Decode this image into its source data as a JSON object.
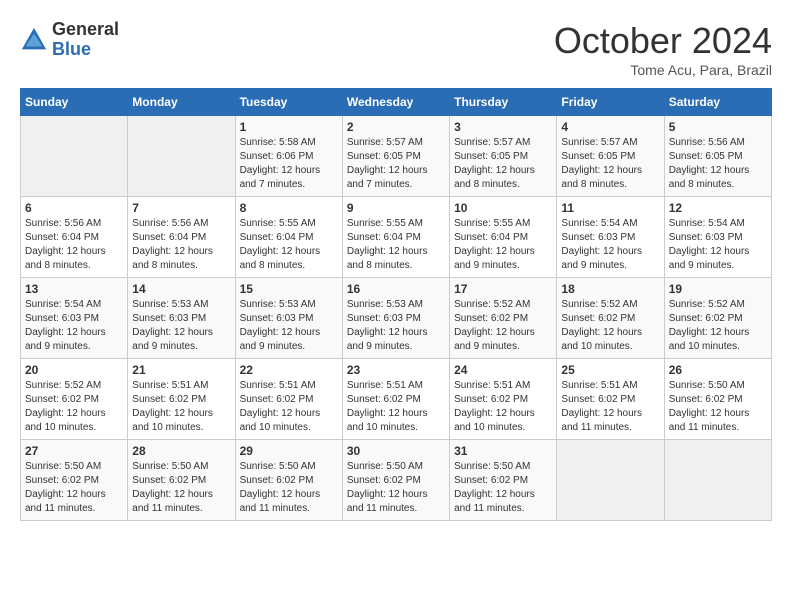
{
  "logo": {
    "general": "General",
    "blue": "Blue"
  },
  "title": "October 2024",
  "subtitle": "Tome Acu, Para, Brazil",
  "days_of_week": [
    "Sunday",
    "Monday",
    "Tuesday",
    "Wednesday",
    "Thursday",
    "Friday",
    "Saturday"
  ],
  "weeks": [
    [
      {
        "day": "",
        "sunrise": "",
        "sunset": "",
        "daylight": ""
      },
      {
        "day": "",
        "sunrise": "",
        "sunset": "",
        "daylight": ""
      },
      {
        "day": "1",
        "sunrise": "Sunrise: 5:58 AM",
        "sunset": "Sunset: 6:06 PM",
        "daylight": "Daylight: 12 hours and 7 minutes."
      },
      {
        "day": "2",
        "sunrise": "Sunrise: 5:57 AM",
        "sunset": "Sunset: 6:05 PM",
        "daylight": "Daylight: 12 hours and 7 minutes."
      },
      {
        "day": "3",
        "sunrise": "Sunrise: 5:57 AM",
        "sunset": "Sunset: 6:05 PM",
        "daylight": "Daylight: 12 hours and 8 minutes."
      },
      {
        "day": "4",
        "sunrise": "Sunrise: 5:57 AM",
        "sunset": "Sunset: 6:05 PM",
        "daylight": "Daylight: 12 hours and 8 minutes."
      },
      {
        "day": "5",
        "sunrise": "Sunrise: 5:56 AM",
        "sunset": "Sunset: 6:05 PM",
        "daylight": "Daylight: 12 hours and 8 minutes."
      }
    ],
    [
      {
        "day": "6",
        "sunrise": "Sunrise: 5:56 AM",
        "sunset": "Sunset: 6:04 PM",
        "daylight": "Daylight: 12 hours and 8 minutes."
      },
      {
        "day": "7",
        "sunrise": "Sunrise: 5:56 AM",
        "sunset": "Sunset: 6:04 PM",
        "daylight": "Daylight: 12 hours and 8 minutes."
      },
      {
        "day": "8",
        "sunrise": "Sunrise: 5:55 AM",
        "sunset": "Sunset: 6:04 PM",
        "daylight": "Daylight: 12 hours and 8 minutes."
      },
      {
        "day": "9",
        "sunrise": "Sunrise: 5:55 AM",
        "sunset": "Sunset: 6:04 PM",
        "daylight": "Daylight: 12 hours and 8 minutes."
      },
      {
        "day": "10",
        "sunrise": "Sunrise: 5:55 AM",
        "sunset": "Sunset: 6:04 PM",
        "daylight": "Daylight: 12 hours and 9 minutes."
      },
      {
        "day": "11",
        "sunrise": "Sunrise: 5:54 AM",
        "sunset": "Sunset: 6:03 PM",
        "daylight": "Daylight: 12 hours and 9 minutes."
      },
      {
        "day": "12",
        "sunrise": "Sunrise: 5:54 AM",
        "sunset": "Sunset: 6:03 PM",
        "daylight": "Daylight: 12 hours and 9 minutes."
      }
    ],
    [
      {
        "day": "13",
        "sunrise": "Sunrise: 5:54 AM",
        "sunset": "Sunset: 6:03 PM",
        "daylight": "Daylight: 12 hours and 9 minutes."
      },
      {
        "day": "14",
        "sunrise": "Sunrise: 5:53 AM",
        "sunset": "Sunset: 6:03 PM",
        "daylight": "Daylight: 12 hours and 9 minutes."
      },
      {
        "day": "15",
        "sunrise": "Sunrise: 5:53 AM",
        "sunset": "Sunset: 6:03 PM",
        "daylight": "Daylight: 12 hours and 9 minutes."
      },
      {
        "day": "16",
        "sunrise": "Sunrise: 5:53 AM",
        "sunset": "Sunset: 6:03 PM",
        "daylight": "Daylight: 12 hours and 9 minutes."
      },
      {
        "day": "17",
        "sunrise": "Sunrise: 5:52 AM",
        "sunset": "Sunset: 6:02 PM",
        "daylight": "Daylight: 12 hours and 9 minutes."
      },
      {
        "day": "18",
        "sunrise": "Sunrise: 5:52 AM",
        "sunset": "Sunset: 6:02 PM",
        "daylight": "Daylight: 12 hours and 10 minutes."
      },
      {
        "day": "19",
        "sunrise": "Sunrise: 5:52 AM",
        "sunset": "Sunset: 6:02 PM",
        "daylight": "Daylight: 12 hours and 10 minutes."
      }
    ],
    [
      {
        "day": "20",
        "sunrise": "Sunrise: 5:52 AM",
        "sunset": "Sunset: 6:02 PM",
        "daylight": "Daylight: 12 hours and 10 minutes."
      },
      {
        "day": "21",
        "sunrise": "Sunrise: 5:51 AM",
        "sunset": "Sunset: 6:02 PM",
        "daylight": "Daylight: 12 hours and 10 minutes."
      },
      {
        "day": "22",
        "sunrise": "Sunrise: 5:51 AM",
        "sunset": "Sunset: 6:02 PM",
        "daylight": "Daylight: 12 hours and 10 minutes."
      },
      {
        "day": "23",
        "sunrise": "Sunrise: 5:51 AM",
        "sunset": "Sunset: 6:02 PM",
        "daylight": "Daylight: 12 hours and 10 minutes."
      },
      {
        "day": "24",
        "sunrise": "Sunrise: 5:51 AM",
        "sunset": "Sunset: 6:02 PM",
        "daylight": "Daylight: 12 hours and 10 minutes."
      },
      {
        "day": "25",
        "sunrise": "Sunrise: 5:51 AM",
        "sunset": "Sunset: 6:02 PM",
        "daylight": "Daylight: 12 hours and 11 minutes."
      },
      {
        "day": "26",
        "sunrise": "Sunrise: 5:50 AM",
        "sunset": "Sunset: 6:02 PM",
        "daylight": "Daylight: 12 hours and 11 minutes."
      }
    ],
    [
      {
        "day": "27",
        "sunrise": "Sunrise: 5:50 AM",
        "sunset": "Sunset: 6:02 PM",
        "daylight": "Daylight: 12 hours and 11 minutes."
      },
      {
        "day": "28",
        "sunrise": "Sunrise: 5:50 AM",
        "sunset": "Sunset: 6:02 PM",
        "daylight": "Daylight: 12 hours and 11 minutes."
      },
      {
        "day": "29",
        "sunrise": "Sunrise: 5:50 AM",
        "sunset": "Sunset: 6:02 PM",
        "daylight": "Daylight: 12 hours and 11 minutes."
      },
      {
        "day": "30",
        "sunrise": "Sunrise: 5:50 AM",
        "sunset": "Sunset: 6:02 PM",
        "daylight": "Daylight: 12 hours and 11 minutes."
      },
      {
        "day": "31",
        "sunrise": "Sunrise: 5:50 AM",
        "sunset": "Sunset: 6:02 PM",
        "daylight": "Daylight: 12 hours and 11 minutes."
      },
      {
        "day": "",
        "sunrise": "",
        "sunset": "",
        "daylight": ""
      },
      {
        "day": "",
        "sunrise": "",
        "sunset": "",
        "daylight": ""
      }
    ]
  ]
}
